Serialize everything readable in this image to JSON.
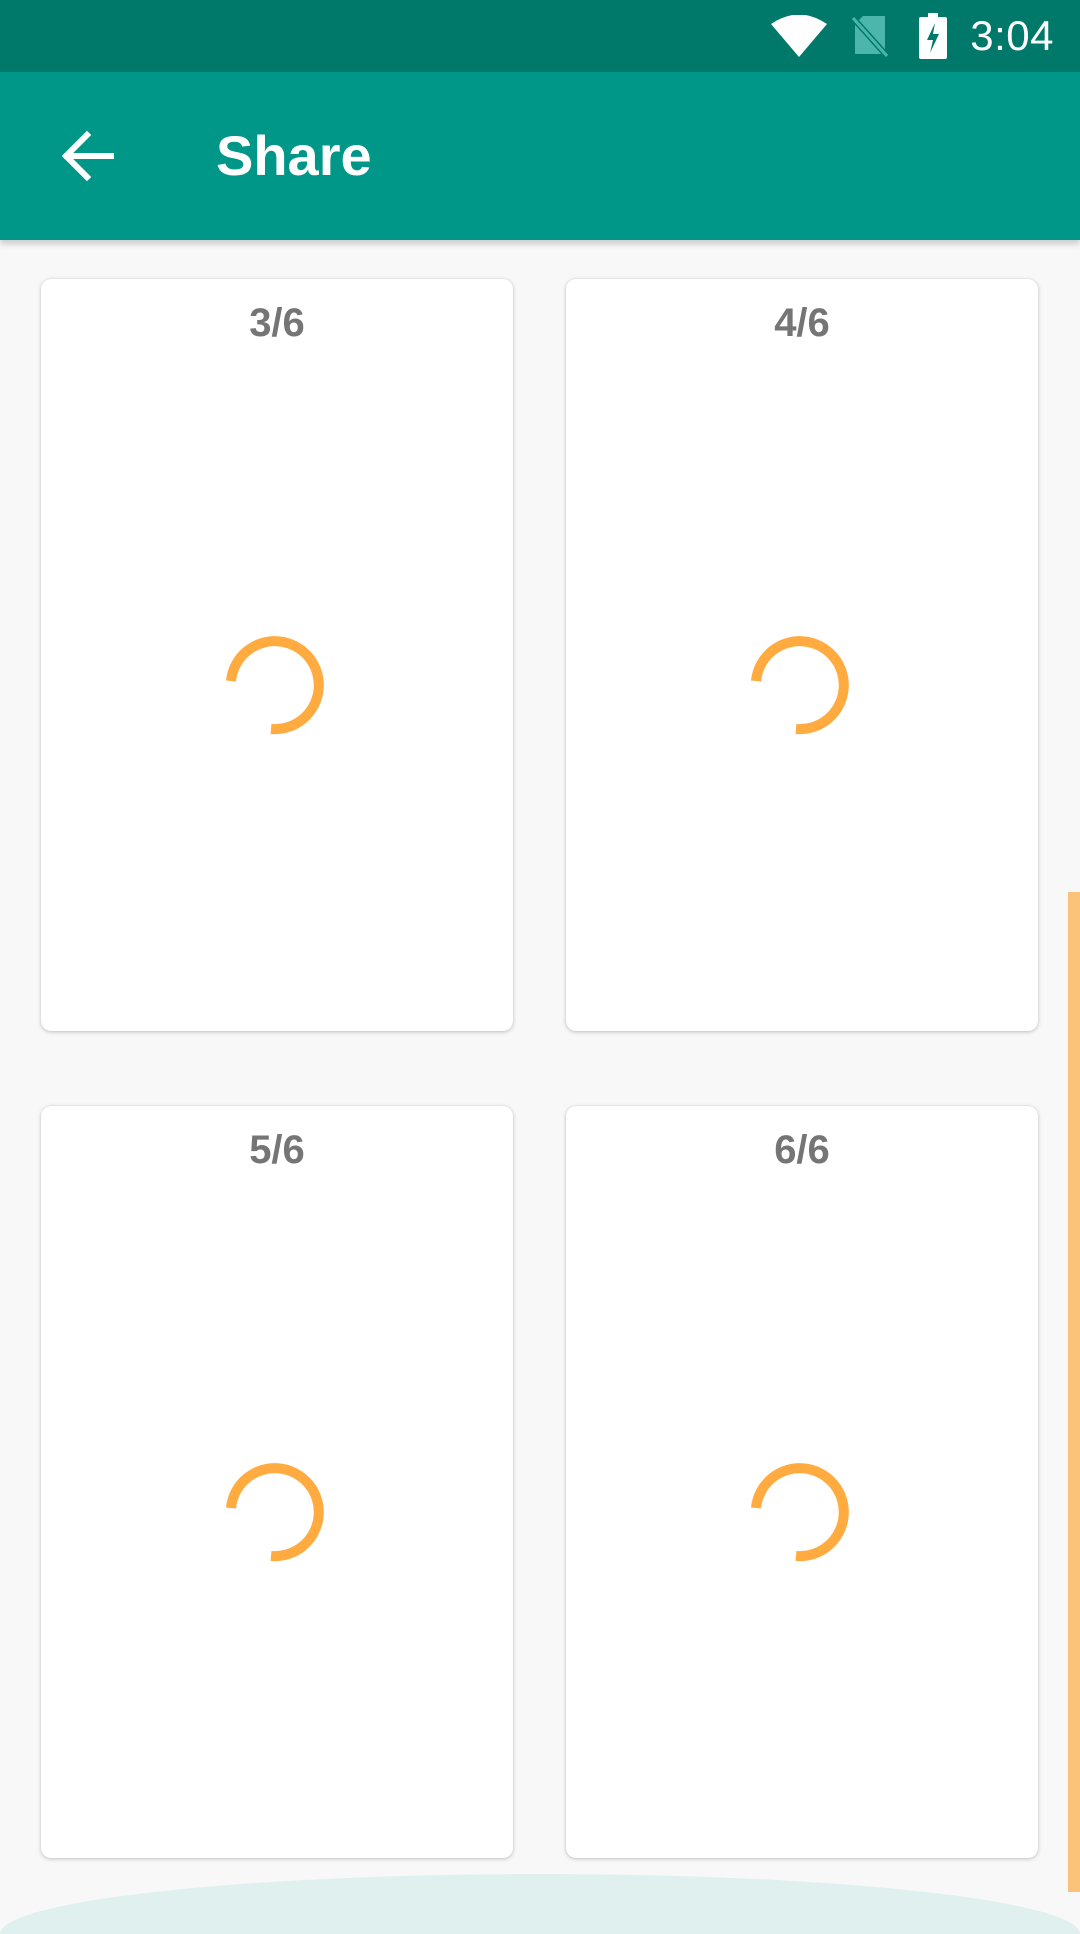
{
  "status_bar": {
    "time": "3:04",
    "icons": [
      "wifi-icon",
      "no-sim-icon",
      "battery-charging-icon"
    ]
  },
  "app_bar": {
    "back_icon": "arrow-back-icon",
    "title": "Share"
  },
  "pages": [
    {
      "label": "3/6",
      "state": "loading"
    },
    {
      "label": "4/6",
      "state": "loading"
    },
    {
      "label": "5/6",
      "state": "loading"
    },
    {
      "label": "6/6",
      "state": "loading"
    }
  ],
  "colors": {
    "status_bar": "#00796b",
    "app_bar": "#009688",
    "spinner": "#ffab40",
    "page_label": "#757575",
    "background": "#f8f8f8"
  }
}
